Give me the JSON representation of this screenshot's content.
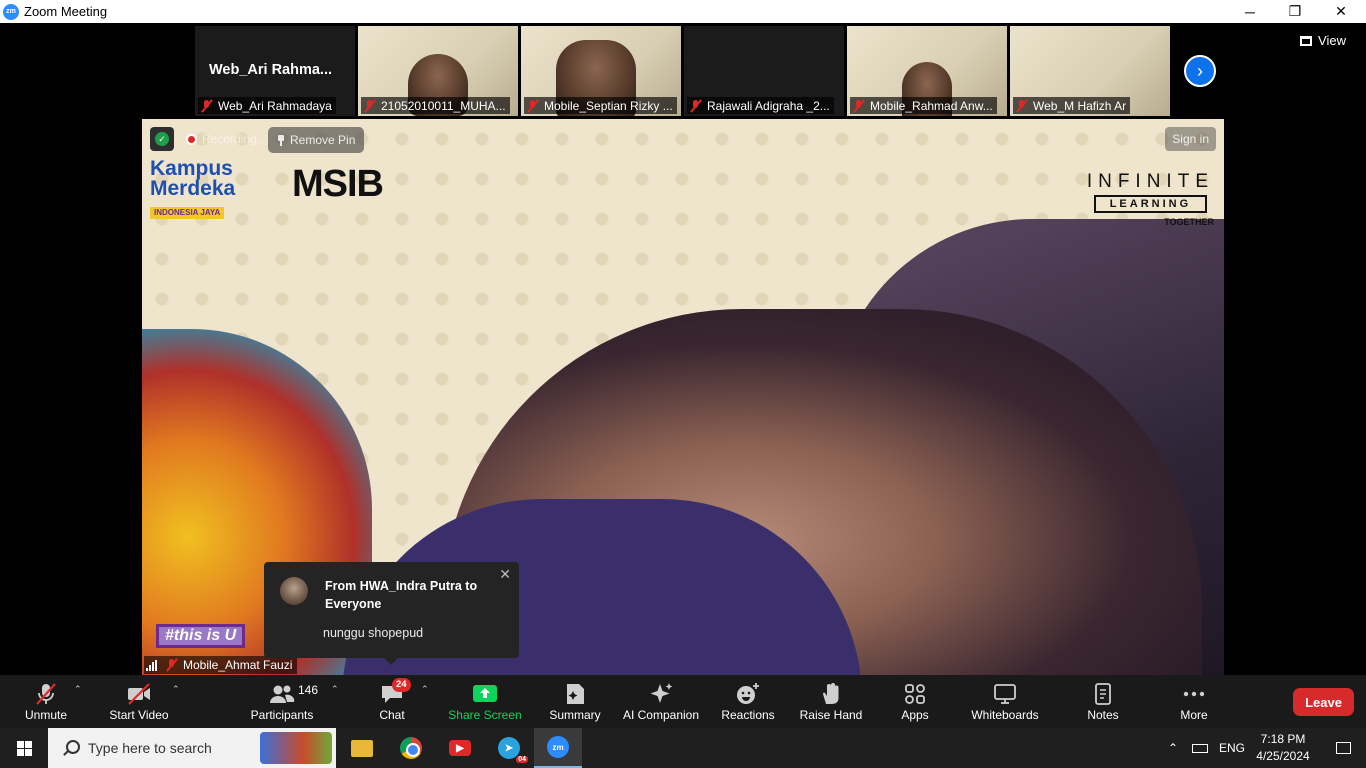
{
  "window": {
    "app_icon": "zoom-logo",
    "logo_text": "zm",
    "title": "Zoom Meeting",
    "controls": {
      "minimize": "─",
      "maximize": "❐",
      "close": "✕"
    }
  },
  "gallery": {
    "tiles": [
      {
        "big_name": "Web_Ari  Rahma...",
        "label": "Web_Ari Rahmadaya",
        "video": false
      },
      {
        "label": "21052010011_MUHA...",
        "video": true
      },
      {
        "label": "Mobile_Septian Rizky ...",
        "video": true
      },
      {
        "label": "Rajawali Adigraha _2...",
        "video": false
      },
      {
        "label": "Mobile_Rahmad Anw...",
        "video": true
      },
      {
        "label": "Web_M Hafizh Ar",
        "video": true
      }
    ],
    "next_icon": "chevron-right-icon",
    "view_label": "View"
  },
  "main_video": {
    "recording_label": "Recording...",
    "remove_pin_label": "Remove Pin",
    "sign_in_label": "Sign in",
    "participant_name": "Mobile_Ahmat Fauzi",
    "background": {
      "kampus_line1": "Kampus",
      "kampus_line2": "Merdeka",
      "kampus_sub": "INDONESIA JAYA",
      "msib": "MSIB",
      "infinite": "INFINITE",
      "learning": "LEARNING",
      "together": "TOGETHER",
      "hashtag": "#this is U"
    }
  },
  "chat_toast": {
    "from": "From HWA_Indra Putra to Everyone",
    "message": "nunggu shopepud",
    "close": "✕"
  },
  "toolbar": {
    "unmute": "Unmute",
    "start_video": "Start Video",
    "participants": "Participants",
    "participants_count": "146",
    "chat": "Chat",
    "chat_badge": "24",
    "share_screen": "Share Screen",
    "summary": "Summary",
    "ai_companion": "AI Companion",
    "reactions": "Reactions",
    "raise_hand": "Raise Hand",
    "apps": "Apps",
    "whiteboards": "Whiteboards",
    "notes": "Notes",
    "more": "More",
    "leave": "Leave",
    "share_color": "#0fd45b",
    "leave_color": "#d72b2b"
  },
  "taskbar": {
    "search_placeholder": "Type here to search",
    "telegram_badge": "04",
    "zoom_text": "zm",
    "language": "ENG",
    "time": "7:18 PM",
    "date": "4/25/2024"
  }
}
